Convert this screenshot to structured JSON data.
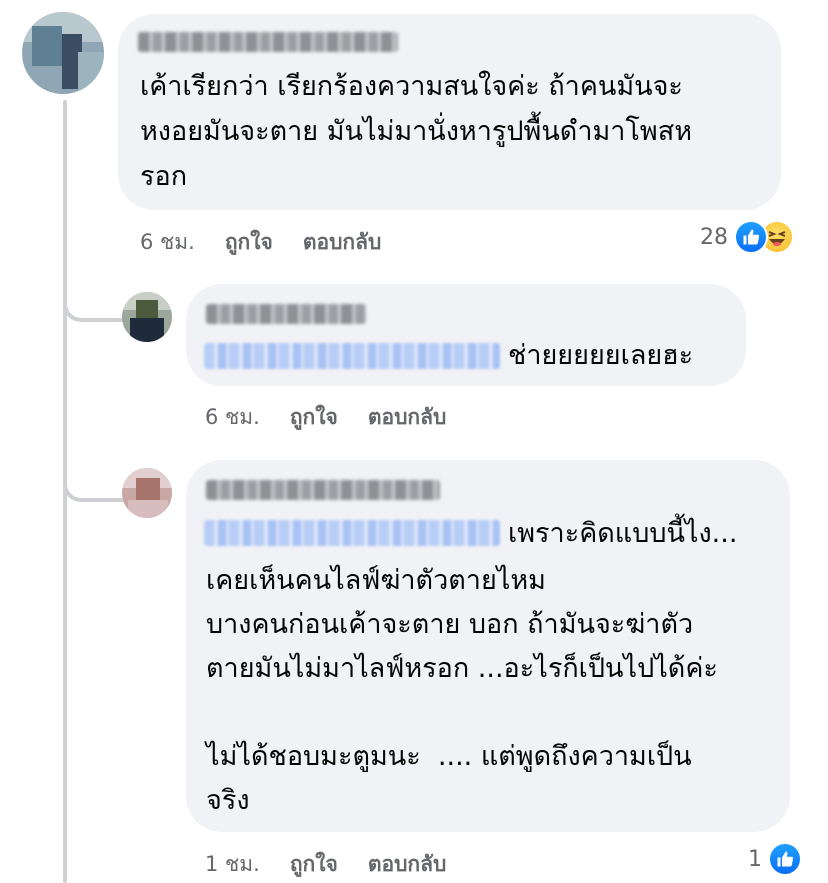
{
  "comments": [
    {
      "text": "เค้าเรียกว่า เรียกร้องความสนใจค่ะ ถ้าคนมันจะ\nหงอยมันจะตาย มันไม่มานั่งหารูปพื้นดำมาโพสห\nรอก",
      "time": "6 ชม.",
      "like_label": "ถูกใจ",
      "reply_label": "ตอบกลับ",
      "reaction_count": "28",
      "reactions": [
        "like-icon",
        "haha-icon"
      ]
    },
    {
      "text": "ช่ายยยยยเลยฮะ",
      "time": "6 ชม.",
      "like_label": "ถูกใจ",
      "reply_label": "ตอบกลับ"
    },
    {
      "text_first_line": "เพราะคิดแบบนี้ไง...",
      "text_rest": "เคยเห็นคนไลฟ์ฆ่าตัวตายไหม\nบางคนก่อนเค้าจะตาย บอก ถ้ามันจะฆ่าตัว\nตายมันไม่มาไลฟ์หรอก ...อะไรก็เป็นไปได้ค่ะ\n\nไม่ได้ชอบมะตูมนะ  .... แต่พูดถึงความเป็น\nจริง",
      "time": "1 ชม.",
      "like_label": "ถูกใจ",
      "reply_label": "ตอบกลับ",
      "reaction_count": "1",
      "reactions": [
        "like-icon"
      ]
    }
  ],
  "colors": {
    "bubble": "#f0f2f5",
    "meta": "#65676b",
    "like": "#1877f2",
    "mention": "#b8cdf6"
  }
}
